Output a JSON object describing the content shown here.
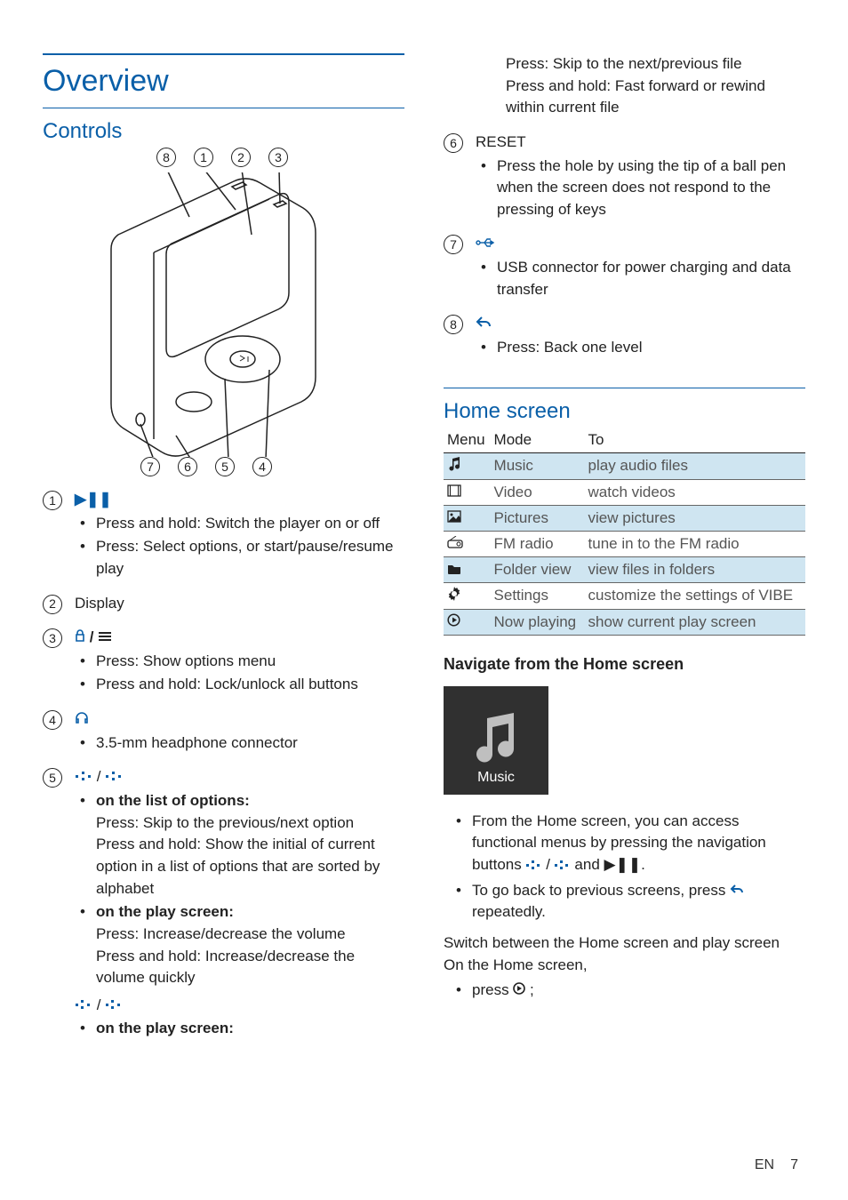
{
  "page": {
    "lang": "EN",
    "number": "7"
  },
  "headings": {
    "overview": "Overview",
    "controls": "Controls",
    "home": "Home screen",
    "navigate": "Navigate from the Home screen",
    "switch": "Switch between the Home screen and play screen",
    "on_home": "On the Home screen,"
  },
  "diagram": {
    "top_nums": [
      "8",
      "1",
      "2",
      "3"
    ],
    "bot_nums": [
      "7",
      "6",
      "5",
      "4"
    ]
  },
  "controls": [
    {
      "num": "1",
      "head_icon": "▶❚❚",
      "bullets": [
        "Press and hold: Switch the player on or off",
        "Press: Select options, or start/pause/resume play"
      ]
    },
    {
      "num": "2",
      "head_text": "Display"
    },
    {
      "num": "3",
      "head_icon_html": "lock-menu",
      "bullets": [
        "Press: Show options menu",
        "Press and hold: Lock/unlock all buttons"
      ]
    },
    {
      "num": "4",
      "head_icon": "♫-headphone",
      "bullets": [
        "3.5-mm headphone connector"
      ]
    },
    {
      "num": "5",
      "head_icon": "dots-ud",
      "groups": [
        {
          "title": "on the list of options:",
          "lines": [
            "Press: Skip to the previous/next option",
            "Press and hold: Show the initial of current option in a list of options that are sorted by alphabet"
          ]
        },
        {
          "title": "on the play screen:",
          "lines": [
            "Press: Increase/decrease the volume",
            "Press and hold: Increase/decrease the volume quickly"
          ]
        }
      ],
      "extra_icon": "dots-lr",
      "extra_group": {
        "title": "on the play screen:"
      }
    }
  ],
  "col2_continuation": [
    "Press: Skip to the next/previous file",
    "Press and hold: Fast forward or rewind within current file"
  ],
  "controls2": [
    {
      "num": "6",
      "head_text": "RESET",
      "bullets": [
        "Press the hole by using the tip of a ball pen when the screen does not respond to the pressing of keys"
      ]
    },
    {
      "num": "7",
      "head_icon": "usb",
      "bullets": [
        "USB connector for power charging and data transfer"
      ]
    },
    {
      "num": "8",
      "head_icon": "back",
      "bullets": [
        "Press: Back one level"
      ]
    }
  ],
  "home_table": {
    "headers": [
      "Menu",
      "Mode",
      "To"
    ],
    "rows": [
      {
        "icon": "music",
        "mode": "Music",
        "to": "play audio files",
        "shade": true
      },
      {
        "icon": "video",
        "mode": "Video",
        "to": "watch videos",
        "shade": false
      },
      {
        "icon": "picture",
        "mode": "Pictures",
        "to": "view pictures",
        "shade": true
      },
      {
        "icon": "radio",
        "mode": "FM radio",
        "to": "tune in to the FM radio",
        "shade": false
      },
      {
        "icon": "folder",
        "mode": "Folder view",
        "to": "view files in folders",
        "shade": true
      },
      {
        "icon": "gear",
        "mode": "Settings",
        "to": "customize the settings of VIBE",
        "shade": false
      },
      {
        "icon": "nowplay",
        "mode": "Now playing",
        "to": "show current play screen",
        "shade": true
      }
    ]
  },
  "music_tile": "Music",
  "nav_bullets": [
    "From the Home screen, you can access functional menus by pressing the navigation buttons",
    "To go back to previous screens, press",
    "repeatedly."
  ],
  "nav_b1_tail": " and ",
  "nav_b1_end": ".",
  "press_now": "press",
  "semicolon": " ;"
}
